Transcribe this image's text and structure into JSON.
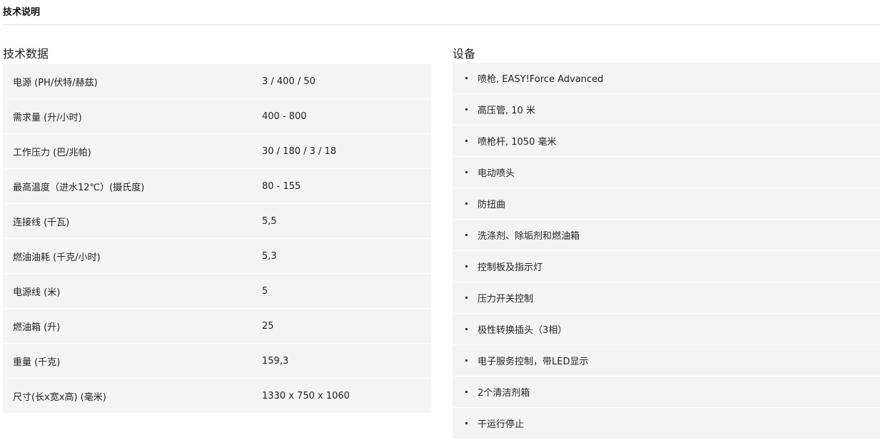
{
  "section_header": "技术说明",
  "tech": {
    "title": "技术数据",
    "rows": [
      {
        "label": "电源 (PH/伏特/赫兹)",
        "value": "3 / 400 / 50"
      },
      {
        "label": "需求量 (升/小时)",
        "value": "400 - 800"
      },
      {
        "label": "工作压力 (巴/兆帕)",
        "value": "30 / 180 / 3 / 18"
      },
      {
        "label": "最高温度（进水12℃）(摄氏度)",
        "value": "80 - 155"
      },
      {
        "label": "连接线 (千瓦)",
        "value": "5,5"
      },
      {
        "label": "燃油油耗 (千克/小时)",
        "value": "5,3"
      },
      {
        "label": "电源线 (米)",
        "value": "5"
      },
      {
        "label": "燃油箱 (升)",
        "value": "25"
      },
      {
        "label": "重量 (千克)",
        "value": "159,3"
      },
      {
        "label": "尺寸(长x宽x高) (毫米)",
        "value": "1330 x 750 x 1060"
      }
    ]
  },
  "equipment": {
    "title": "设备",
    "items": [
      "喷枪, EASY!Force Advanced",
      "高压管, 10 米",
      "喷枪杆, 1050 毫米",
      "电动喷头",
      "防扭曲",
      "洗涤剂、除垢剂和燃油箱",
      "控制板及指示灯",
      "压力开关控制",
      "极性转换插头（3相）",
      "电子服务控制，带LED显示",
      "2个清洁剂箱",
      "干运行停止"
    ]
  }
}
